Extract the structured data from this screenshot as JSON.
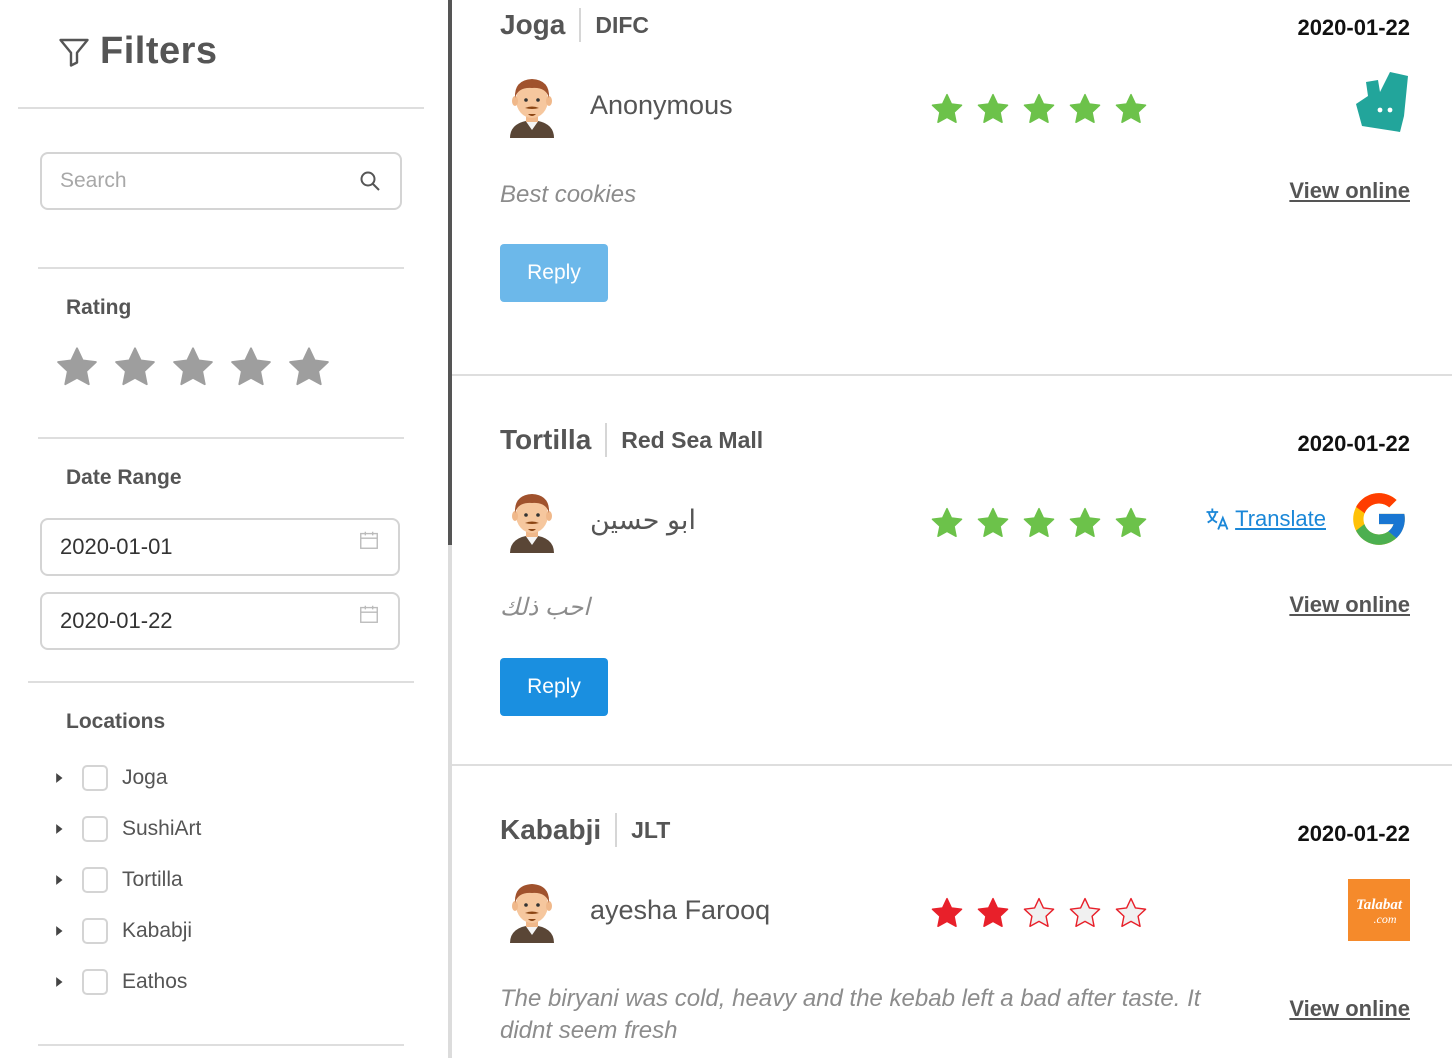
{
  "sidebar": {
    "title": "Filters",
    "search": {
      "placeholder": "Search"
    },
    "rating": {
      "label": "Rating",
      "stars": 5
    },
    "date_range": {
      "label": "Date Range",
      "start": "2020-01-01",
      "end": "2020-01-22"
    },
    "locations": {
      "label": "Locations",
      "items": [
        {
          "label": "Joga"
        },
        {
          "label": "SushiArt"
        },
        {
          "label": "Tortilla"
        },
        {
          "label": "Kababji"
        },
        {
          "label": "Eathos"
        }
      ]
    }
  },
  "reviews": [
    {
      "brand": "Joga",
      "location": "DIFC",
      "date": "2020-01-22",
      "author": "Anonymous",
      "rating": 5,
      "star_color": "#6cc24a",
      "platform_icon": "deliveroo-logo",
      "text": "Best cookies",
      "view_online": "View online",
      "reply": "Reply"
    },
    {
      "brand": "Tortilla",
      "location": "Red Sea Mall",
      "date": "2020-01-22",
      "author": "ابو حسين",
      "rating": 5,
      "star_color": "#6cc24a",
      "platform_icon": "google-logo",
      "translate": "Translate",
      "text": "احب ذلك",
      "view_online": "View online",
      "reply": "Reply"
    },
    {
      "brand": "Kababji",
      "location": "JLT",
      "date": "2020-01-22",
      "author": "ayesha Farooq",
      "rating": 2,
      "star_color": "#e8202a",
      "platform_icon": "talabat-logo",
      "platform_logo_text": "Talabat.com",
      "text": "The biryani was cold, heavy and the kebab left a bad after taste. It didnt seem fresh",
      "view_online": "View online"
    }
  ],
  "colors": {
    "accent": "#1a8fe0",
    "reply_light": "#6cb8ea",
    "star_positive": "#6cc24a",
    "star_negative": "#e8202a",
    "star_filter": "#9e9e9e"
  }
}
